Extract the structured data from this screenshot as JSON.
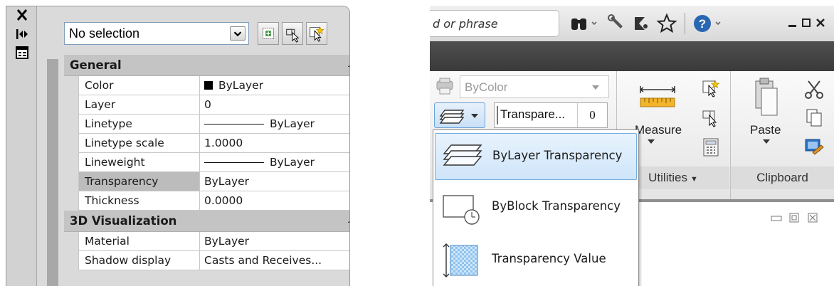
{
  "properties_palette": {
    "selection": {
      "value": "No selection"
    },
    "categories": [
      {
        "label": "General",
        "rows": [
          {
            "name": "Color",
            "value": "ByLayer",
            "kind": "color"
          },
          {
            "name": "Layer",
            "value": "0",
            "kind": "text"
          },
          {
            "name": "Linetype",
            "value": "ByLayer",
            "kind": "line"
          },
          {
            "name": "Linetype scale",
            "value": "1.0000",
            "kind": "text"
          },
          {
            "name": "Lineweight",
            "value": "ByLayer",
            "kind": "line"
          },
          {
            "name": "Transparency",
            "value": "ByLayer",
            "kind": "text",
            "selected": true
          },
          {
            "name": "Thickness",
            "value": "0.0000",
            "kind": "text"
          }
        ]
      },
      {
        "label": "3D Visualization",
        "rows": [
          {
            "name": "Material",
            "value": "ByLayer",
            "kind": "text"
          },
          {
            "name": "Shadow display",
            "value": "Casts and Receives...",
            "kind": "text"
          }
        ]
      }
    ],
    "icons": [
      "close-icon",
      "autohide-icon",
      "properties-menu-icon",
      "quick-select-icon",
      "select-objects-icon",
      "toggle-pickadd-icon"
    ]
  },
  "ribbon": {
    "search": {
      "text": "d or phrase"
    },
    "title_icons": [
      "binoculars-icon",
      "wrench-icon",
      "communication-center-icon",
      "favorites-star-icon",
      "help-icon",
      "minimize-icon",
      "restore-icon",
      "close-icon"
    ],
    "properties_panel": {
      "color_value": "ByColor",
      "transparency_label": "Transpare...",
      "transparency_value": "0"
    },
    "utilities": {
      "title": "Utilities",
      "measure_label": "Measure"
    },
    "clipboard": {
      "title": "Clipboard",
      "paste_label": "Paste"
    },
    "transparency_menu": [
      {
        "label": "ByLayer Transparency",
        "icon": "bylayer-transparency-icon",
        "highlighted": true
      },
      {
        "label": "ByBlock Transparency",
        "icon": "byblock-transparency-icon",
        "highlighted": false
      },
      {
        "label": "Transparency Value",
        "icon": "transparency-value-icon",
        "highlighted": false
      }
    ],
    "accent_color": "#74acdf"
  }
}
